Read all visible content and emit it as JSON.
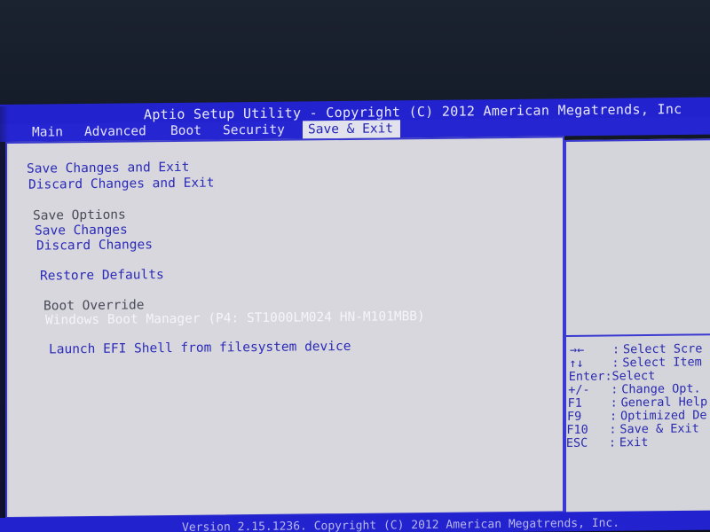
{
  "title": "Aptio Setup Utility - Copyright (C) 2012 American Megatrends, Inc",
  "tabs": [
    {
      "label": "Main"
    },
    {
      "label": "Advanced"
    },
    {
      "label": "Boot"
    },
    {
      "label": "Security"
    },
    {
      "label": "Save & Exit"
    }
  ],
  "active_tab": "Save & Exit",
  "menu": {
    "save_changes_and_exit": "Save Changes and Exit",
    "discard_changes_and_exit": "Discard Changes and Exit",
    "save_options_header": "Save Options",
    "save_changes": "Save Changes",
    "discard_changes": "Discard Changes",
    "restore_defaults": "Restore Defaults",
    "boot_override_header": "Boot Override",
    "windows_boot_manager": "Windows Boot Manager (P4: ST1000LM024 HN-M101MBB)",
    "launch_efi_shell": "Launch EFI Shell from filesystem device"
  },
  "help": [
    {
      "key": "→←",
      "sep": ":",
      "desc": "Select Scre"
    },
    {
      "key": "↑↓",
      "sep": ":",
      "desc": "Select Item"
    },
    {
      "key": "Enter",
      "sep": ":",
      "desc": "Select"
    },
    {
      "key": "+/-",
      "sep": ":",
      "desc": "Change Opt."
    },
    {
      "key": "F1",
      "sep": ":",
      "desc": "General Help"
    },
    {
      "key": "F9",
      "sep": ":",
      "desc": "Optimized De"
    },
    {
      "key": "F10",
      "sep": ":",
      "desc": "Save & Exit"
    },
    {
      "key": "ESC",
      "sep": ":",
      "desc": "Exit"
    }
  ],
  "footer": "Version 2.15.1236. Copyright (C) 2012 American Megatrends, Inc.",
  "colors": {
    "title_bar": "#2222cf",
    "panel_bg": "#d7d7dd",
    "item_blue": "#2b2bb8",
    "item_gray": "#4a4a58",
    "item_selected": "#f4f4fa"
  }
}
